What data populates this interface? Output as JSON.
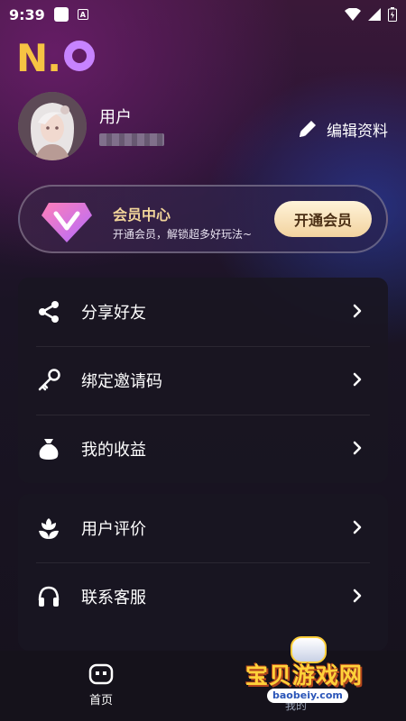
{
  "status_bar": {
    "time": "9:39",
    "notification_letter": "A"
  },
  "brand": {
    "logo_text": "N",
    "logo_dot": ".",
    "logo_color": "#f6c343",
    "logo_accent": "#c783ff"
  },
  "profile": {
    "username": "用户",
    "edit_label": "编辑资料"
  },
  "vip": {
    "title": "会员中心",
    "subtitle": "开通会员，解锁超多好玩法~",
    "button_label": "开通会员",
    "title_color": "#f2d59a"
  },
  "menu_group_1": [
    {
      "label": "分享好友",
      "icon": "share-icon"
    },
    {
      "label": "绑定邀请码",
      "icon": "key-icon"
    },
    {
      "label": "我的收益",
      "icon": "money-bag-icon"
    }
  ],
  "menu_group_2": [
    {
      "label": "用户评价",
      "icon": "flower-icon"
    },
    {
      "label": "联系客服",
      "icon": "headphones-icon"
    }
  ],
  "tab_bar": {
    "home_label": "首页",
    "mine_label": "我的"
  },
  "watermark": {
    "text": "宝贝游戏网",
    "url": "baobeiy.com"
  }
}
